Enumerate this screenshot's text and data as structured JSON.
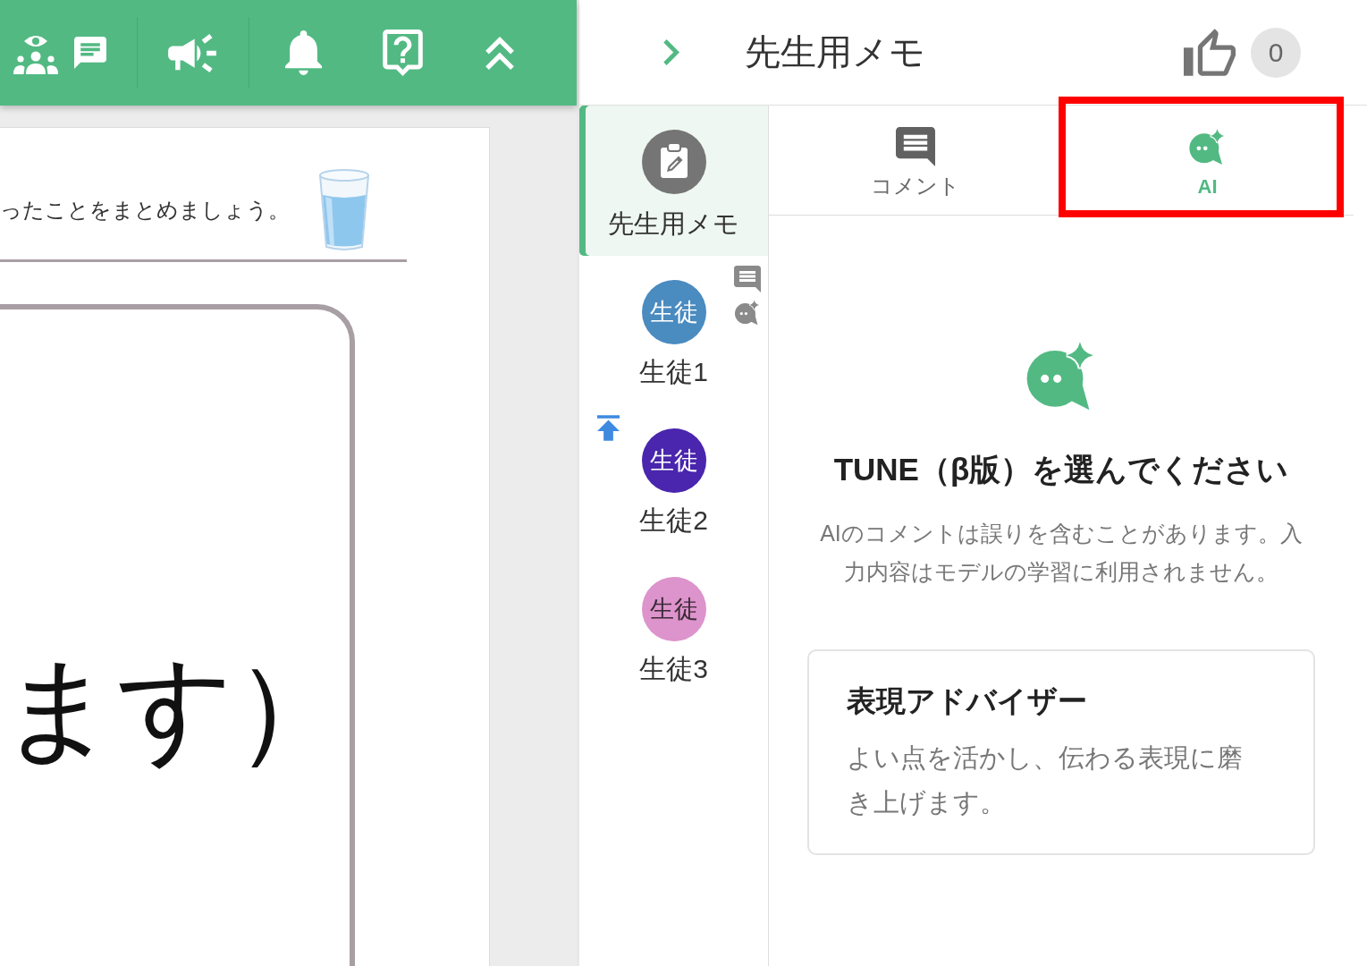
{
  "document": {
    "instruction": "ったことをまとめましょう。",
    "answer": "ます）"
  },
  "panel": {
    "title": "先生用メモ",
    "like_count": "0"
  },
  "sidebar": {
    "items": [
      {
        "kind": "memo",
        "label": "先生用メモ",
        "selected": true
      },
      {
        "kind": "student",
        "avatar_text": "生徒",
        "label": "生徒1",
        "color": "#4a8bc0",
        "selected": false,
        "has_comment": true,
        "has_ai_comment": true,
        "move_to_top": false
      },
      {
        "kind": "student",
        "avatar_text": "生徒",
        "label": "生徒2",
        "color": "#4a25ad",
        "selected": false,
        "has_comment": false,
        "has_ai_comment": false,
        "move_to_top": true
      },
      {
        "kind": "student",
        "avatar_text": "生徒",
        "label": "生徒3",
        "color": "#dd93cb",
        "selected": false,
        "has_comment": false,
        "has_ai_comment": false,
        "move_to_top": false
      }
    ]
  },
  "tabs": [
    {
      "kind": "comment",
      "label": "コメント",
      "selected": false,
      "highlighted": false
    },
    {
      "kind": "ai",
      "label": "AI",
      "selected": true,
      "highlighted": true
    }
  ],
  "ai_pane": {
    "heading": "TUNE（β版）を選んでください",
    "note": "AIのコメントは誤りを含むことがあります。入力内容はモデルの学習に利用されません。",
    "advisors": [
      {
        "title": "表現アドバイザー",
        "description": "よい点を活かし、伝わる表現に磨き上げます。"
      }
    ]
  }
}
